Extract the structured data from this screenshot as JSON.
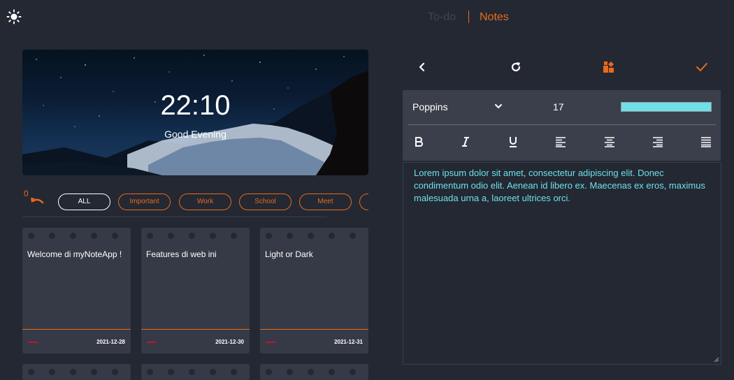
{
  "topbar": {
    "tab_todo": "To-do",
    "tab_notes": "Notes",
    "theme_icon": "sun-icon"
  },
  "hero": {
    "time": "22:10",
    "greeting": "Good Evening"
  },
  "filter": {
    "count": "0",
    "chips": [
      "ALL",
      "Important",
      "Work",
      "School",
      "Meet",
      ""
    ],
    "active": "ALL"
  },
  "notes": [
    {
      "title": "Welcome di myNoteApp !",
      "date": "2021-12-28"
    },
    {
      "title": "Features di web ini",
      "date": "2021-12-30"
    },
    {
      "title": "Light or Dark",
      "date": "2021-12-31"
    }
  ],
  "editor": {
    "font": "Poppins",
    "font_size": "17",
    "text_color": "#6ee0e8",
    "body": "Lorem ipsum dolor sit amet, consectetur adipiscing elit. Donec condimentum odio elit. Aenean id libero ex. Maecenas ex eros, maximus malesuada urna a, laoreet ultrices orci."
  },
  "colors": {
    "accent": "#ea6a1b",
    "background": "#232833",
    "card": "#353a46"
  }
}
